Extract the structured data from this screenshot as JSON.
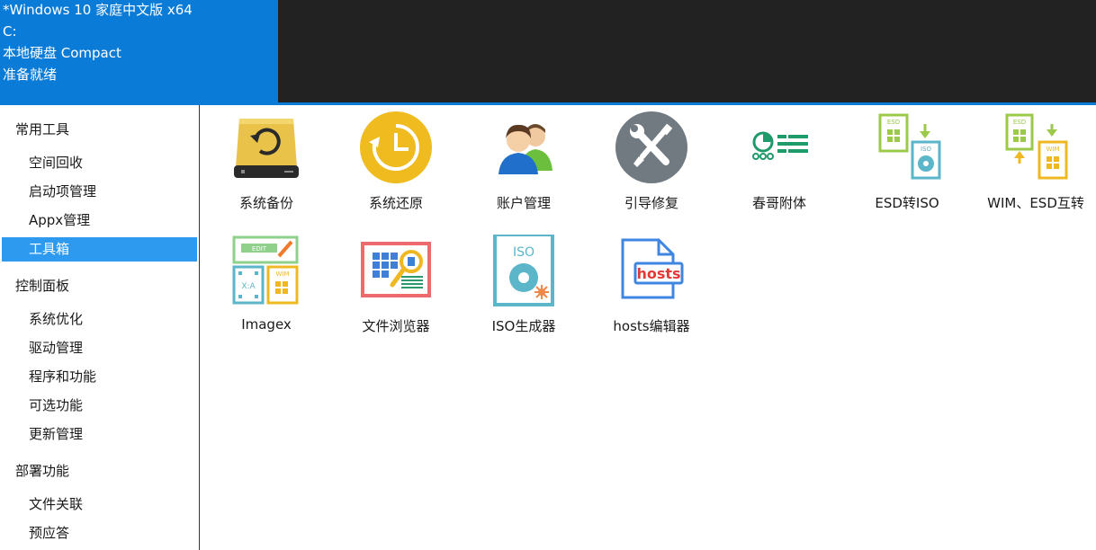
{
  "sysinfo": {
    "os": "*Windows 10 家庭中文版 x64",
    "drive": "C:",
    "disk": "本地硬盘 Compact",
    "status": "准备就绪"
  },
  "sidebar": {
    "categories": [
      {
        "label": "常用工具",
        "items": [
          {
            "label": "空间回收"
          },
          {
            "label": "启动项管理"
          },
          {
            "label": "Appx管理"
          },
          {
            "label": "工具箱"
          }
        ]
      },
      {
        "label": "控制面板",
        "items": [
          {
            "label": "系统优化"
          },
          {
            "label": "驱动管理"
          },
          {
            "label": "程序和功能"
          },
          {
            "label": "可选功能"
          },
          {
            "label": "更新管理"
          }
        ]
      },
      {
        "label": "部署功能",
        "items": [
          {
            "label": "文件关联"
          },
          {
            "label": "预应答"
          }
        ]
      }
    ],
    "active_item": "工具箱"
  },
  "tools": [
    {
      "label": "系统备份",
      "icon": "drive-backup-icon"
    },
    {
      "label": "系统还原",
      "icon": "clock-restore-icon"
    },
    {
      "label": "账户管理",
      "icon": "users-icon"
    },
    {
      "label": "引导修复",
      "icon": "wrench-screwdriver-icon"
    },
    {
      "label": "春哥附体",
      "icon": "pie-list-icon"
    },
    {
      "label": "ESD转ISO",
      "icon": "esd-to-iso-icon"
    },
    {
      "label": "WIM、ESD互转",
      "icon": "wim-esd-convert-icon"
    },
    {
      "label": "Imagex",
      "icon": "imagex-icon"
    },
    {
      "label": "文件浏览器",
      "icon": "file-browser-icon"
    },
    {
      "label": "ISO生成器",
      "icon": "iso-maker-icon"
    },
    {
      "label": "hosts编辑器",
      "icon": "hosts-editor-icon"
    }
  ],
  "icon_text": {
    "esd": "ESD",
    "iso": "ISO",
    "wim": "WIM",
    "edit": "EDIT",
    "xa": "X:A",
    "hosts": "hosts"
  },
  "colors": {
    "header_blue": "#0a7bd6",
    "header_dark": "#222222",
    "active_item": "#2d9af0"
  }
}
